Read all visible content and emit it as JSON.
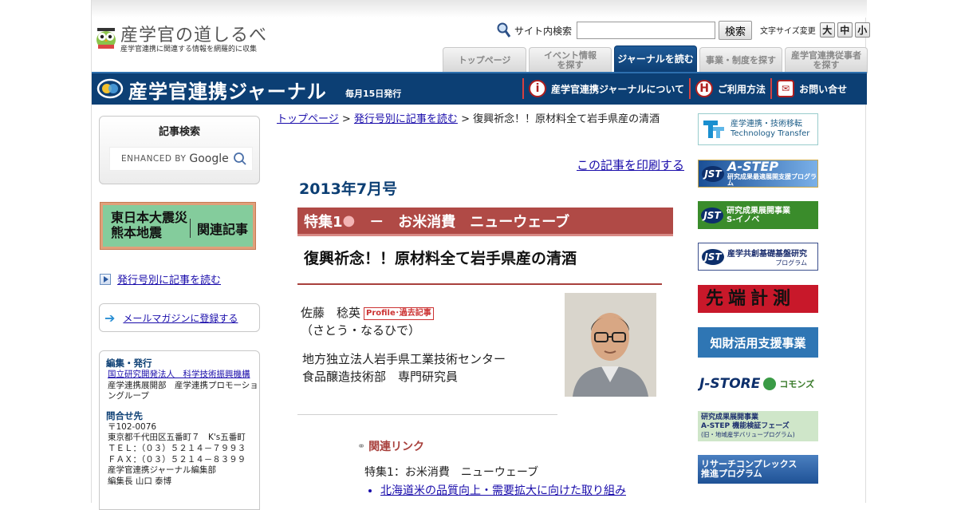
{
  "header": {
    "logo_title": "産学官の道しるべ",
    "logo_sub": "産学官連携に関連する情報を網羅的に収集",
    "search_label": "サイト内検索",
    "search_value": "",
    "search_button": "検索",
    "fontsize_label": "文字サイズ変更",
    "fontsize_large": "大",
    "fontsize_mid": "中",
    "fontsize_small": "小"
  },
  "tabs": [
    {
      "label": "トップページ"
    },
    {
      "label": "イベント情報\nを探す"
    },
    {
      "label": "ジャーナルを読む"
    },
    {
      "label": "事業・制度を探す"
    },
    {
      "label": "産学官連携従事者\nを探す"
    }
  ],
  "journal": {
    "title": "産学官連携ジャーナル",
    "subtitle": "毎月15日発行",
    "links": [
      {
        "label": "産学官連携ジャーナルについて",
        "icon": "i"
      },
      {
        "label": "ご利用方法",
        "icon": "H"
      },
      {
        "label": "お問い合せ",
        "icon": "✉"
      }
    ]
  },
  "sidebar": {
    "kiji_title": "記事検索",
    "google_prefix": "ENHANCED BY",
    "google_name": "Google",
    "disaster_l1": "東日本大震災\n熊本地震",
    "disaster_l2": "関連記事",
    "issue_link": "発行号別に記事を読む",
    "mail_link": "メールマガジンに登録する",
    "pub_heading": "編集・発行",
    "pub_org": "国立研究開発法人　科学技術振興機構",
    "pub_dept": "産学連携展開部　産学連携プロモーショングループ",
    "contact_heading": "問合せ先",
    "contact_lines": [
      "〒102-0076",
      "東京都千代田区五番町７　K's五番町",
      "ＴＥＬ：（０３）５２１４－７９９３",
      "ＦＡＸ：（０３）５２１４－８３９９",
      "産学官連携ジャーナル編集部",
      "編集長 山口 泰博"
    ]
  },
  "main": {
    "crumb_top": "トップページ",
    "crumb_issue": "発行号別に記事を読む",
    "crumb_current": "復興祈念！！原材料全て岩手県産の清酒",
    "print_link": "この記事を印刷する",
    "issue": "2013年7月号",
    "feature_label": "特集1",
    "feature_title": "－　お米消費　ニューウェーブ",
    "article_title": "復興祈念！！原材料全て岩手県産の清酒",
    "author_name": "佐藤　稔英",
    "author_badge": "Profile･過去記事",
    "author_reading": "（さとう・なるひで）",
    "org_line1": "地方独立法人岩手県工業技術センター",
    "org_line2": "食品醸造技術部　専門研究員",
    "related_heading": "関連リンク",
    "related_item": "特集1：お米消費　ニューウェーブ",
    "related_links": [
      "北海道米の品質向上・需要拡大に向けた取り組み"
    ]
  },
  "banners": {
    "b1": "産学連携・技術移転\nTechnology Transfer",
    "b2": "A-STEP",
    "b2_sub": "研究成果最適展開支援プログラム",
    "b3": "研究成果展開事業\nS-イノベ",
    "b4": "産学共創基礎基盤研究",
    "b4_sub": "プログラム",
    "b5": "先端計測",
    "b6": "知財活用支援事業",
    "b7": "J-STORE",
    "b7_sub": "コモンズ",
    "b8": "研究成果展開事業\nA-STEP 機能検証フェーズ",
    "b8_sub": "(旧・地域産学バリュープログラム)",
    "b9": "リサーチコンプレックス\n推進プログラム"
  }
}
